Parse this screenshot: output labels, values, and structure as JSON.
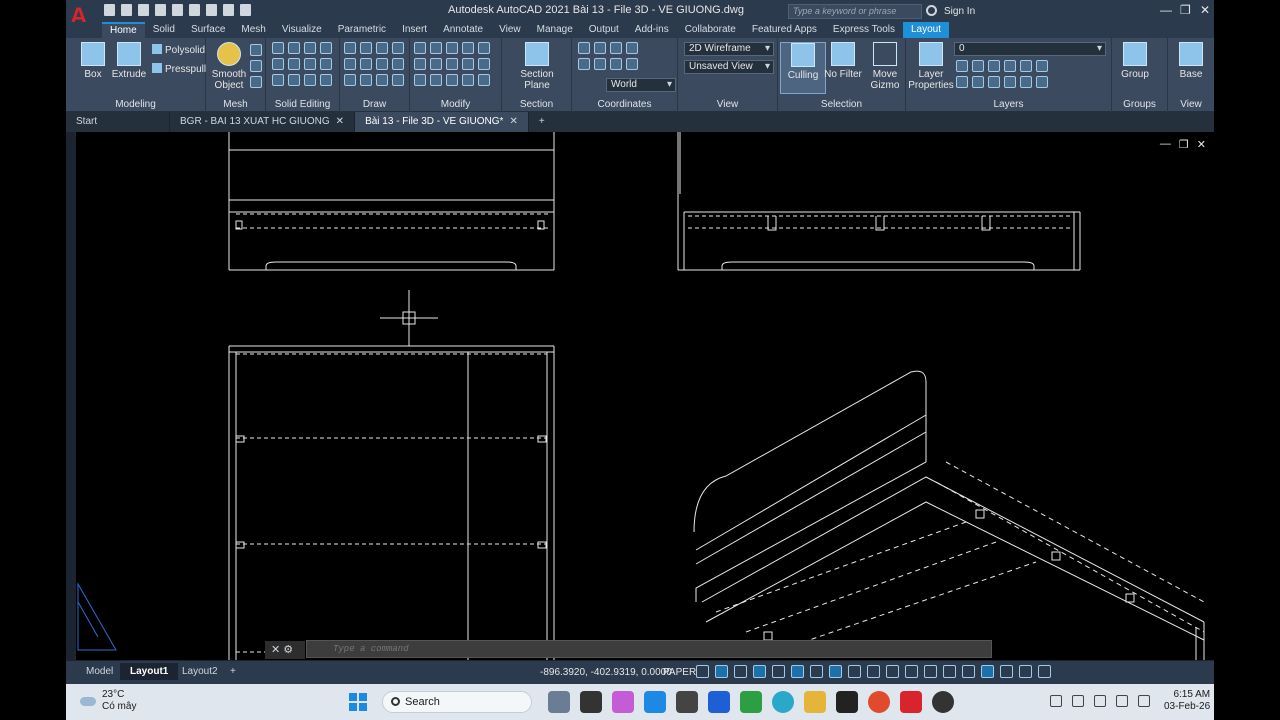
{
  "window": {
    "title": "Autodesk AutoCAD 2021   Bài 13 - File 3D - VE GIUONG.dwg",
    "search_placeholder": "Type a keyword or phrase",
    "sign_in": "Sign In"
  },
  "ribbon_tabs": [
    "Home",
    "Solid",
    "Surface",
    "Mesh",
    "Visualize",
    "Parametric",
    "Insert",
    "Annotate",
    "View",
    "Manage",
    "Output",
    "Add-ins",
    "Collaborate",
    "Featured Apps",
    "Express Tools",
    "Layout"
  ],
  "ribbon": {
    "modeling": {
      "label": "Modeling",
      "box": "Box",
      "extrude": "Extrude",
      "polysolid": "Polysolid",
      "presspull": "Presspull"
    },
    "mesh": {
      "label": "Mesh",
      "smooth_object": "Smooth Object"
    },
    "solid_editing": {
      "label": "Solid Editing"
    },
    "draw": {
      "label": "Draw"
    },
    "modify": {
      "label": "Modify"
    },
    "section": {
      "label": "Section",
      "section_plane": "Section Plane"
    },
    "coordinates": {
      "label": "Coordinates",
      "world": "World"
    },
    "view": {
      "label": "View",
      "visual_style": "2D Wireframe",
      "saved_view": "Unsaved View"
    },
    "selection": {
      "label": "Selection",
      "culling": "Culling",
      "no_filter": "No Filter",
      "move_gizmo": "Move Gizmo"
    },
    "layers": {
      "label": "Layers",
      "layer_properties": "Layer Properties",
      "current_layer": "0"
    },
    "groups": {
      "label": "Groups",
      "group": "Group"
    },
    "view2": {
      "label": "View",
      "base": "Base"
    }
  },
  "doc_tabs": [
    "Start",
    "BGR - BAI 13 XUAT HC GIUONG",
    "Bài 13 - File 3D - VE GIUONG*"
  ],
  "command_line": {
    "placeholder": "Type a command"
  },
  "layout_tabs": [
    "Model",
    "Layout1",
    "Layout2"
  ],
  "status": {
    "coordinates": "-896.3920, -402.9319, 0.0000",
    "space": "PAPER"
  },
  "taskbar": {
    "temperature": "23°C",
    "weather_text": "Có mây",
    "search_label": "Search",
    "time": "6:15 AM",
    "date": "03-Feb-26"
  }
}
